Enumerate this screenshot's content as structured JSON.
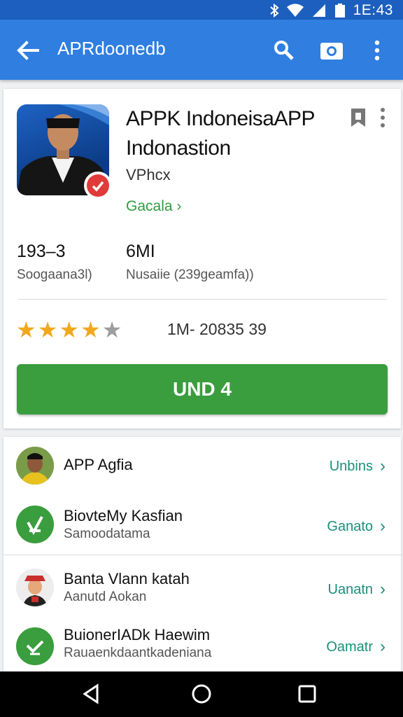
{
  "status_bar": {
    "time": "1E:43"
  },
  "app_bar": {
    "title": "APRdoonedb"
  },
  "app": {
    "title_line1": "APPK IndoneisaAPP",
    "title_line2": "Indonastion",
    "developer": "VPhcx",
    "category": "Gacala",
    "stat1_value": "193–3",
    "stat1_label": "Soogaana3l)",
    "stat2_value": "6MI",
    "stat2_label": "Nusaiie (239geamfa))",
    "rating_stars": 4,
    "rating_text": "1M- 20835 39",
    "install_label": "UND 4"
  },
  "related": [
    {
      "name": "APP Agfia",
      "sub": "",
      "action": "Unbins"
    },
    {
      "name": "BiovteMy Kasfian",
      "sub": "Samoodatama",
      "action": "Ganato"
    },
    {
      "name": "Banta Vlann katah",
      "sub": "Aanutd Aokan",
      "action": "Uanatn"
    },
    {
      "name": "BuionerIADk Haewim",
      "sub": "Rauaenkdaantkadeniana",
      "action": "Oamatr"
    }
  ],
  "colors": {
    "primary": "#2f7ee0",
    "status": "#1d5fbf",
    "install": "#3a9d3e",
    "star": "#f2a81d",
    "link": "#18907a"
  }
}
